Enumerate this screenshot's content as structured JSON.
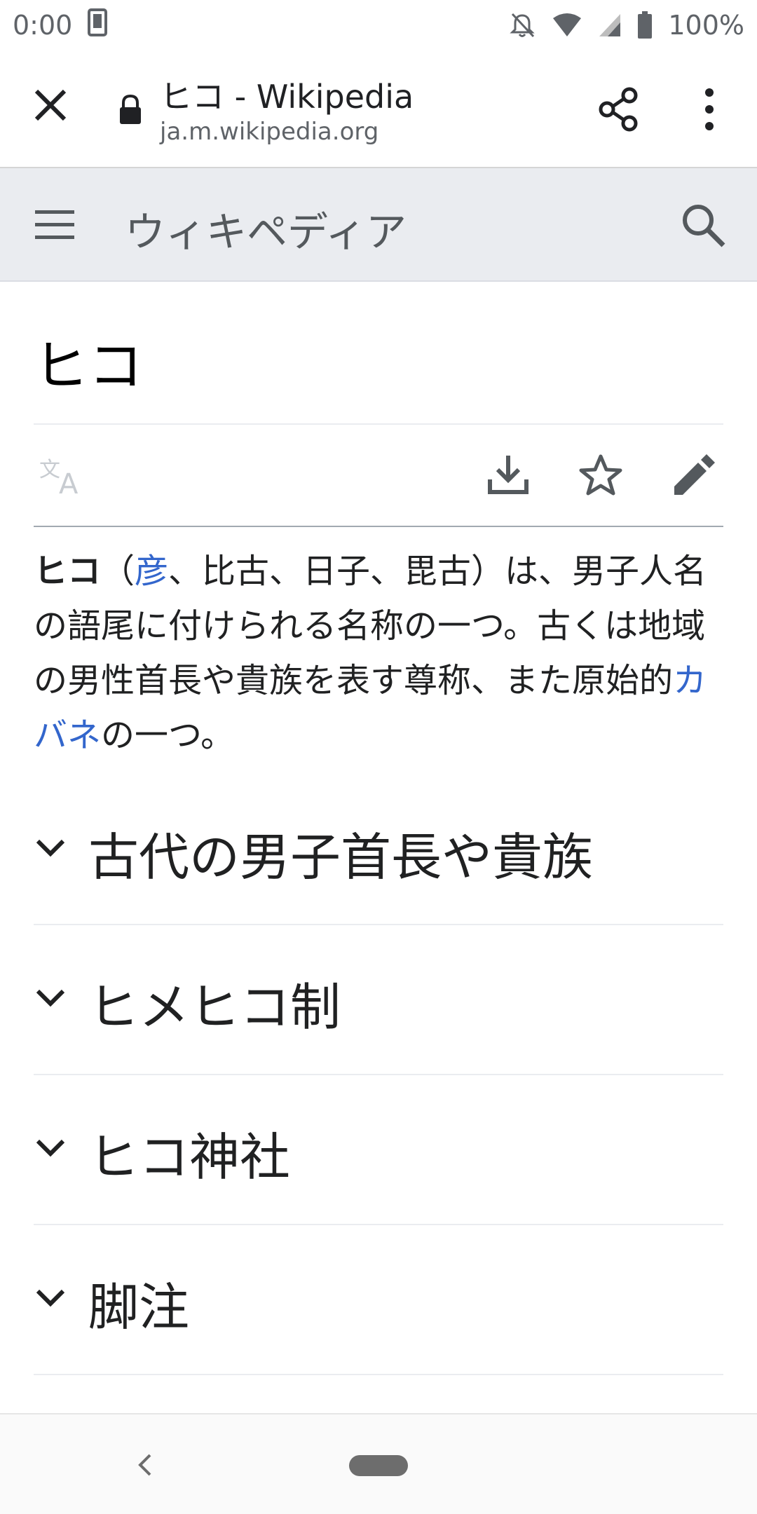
{
  "status_bar": {
    "time": "0:00",
    "battery": "100%"
  },
  "browser": {
    "title": "ヒコ - Wikipedia",
    "url": "ja.m.wikipedia.org"
  },
  "wiki_header": {
    "wordmark": "ウィキペディア"
  },
  "article": {
    "title": "ヒコ",
    "intro": {
      "bold_term": "ヒコ",
      "paren_open": "（",
      "link_1": "彦",
      "mid_text": "、比古、日子、毘古）は、男子人名の語尾に付けられる名称の一つ。古くは地域の男性首長や貴族を表す尊称、また原始的",
      "link_2": "カバネ",
      "end_text": "の一つ。"
    },
    "sections": [
      {
        "title": "古代の男子首長や貴族"
      },
      {
        "title": "ヒメヒコ制"
      },
      {
        "title": "ヒコ神社"
      },
      {
        "title": "脚注"
      }
    ]
  },
  "colors": {
    "link": "#3366cc",
    "header_bg": "#eaecf0",
    "text": "#202122"
  }
}
